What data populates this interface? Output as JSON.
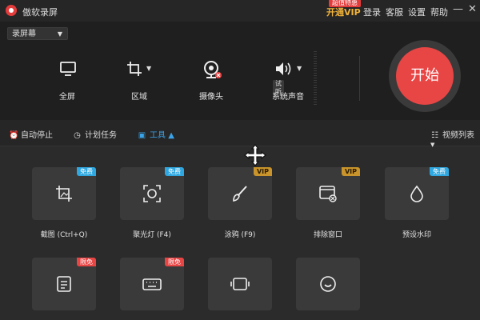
{
  "window": {
    "title": "傲软录屏",
    "vip_link": "开通VIP",
    "vip_badge": "超值特惠",
    "login": "登录",
    "support": "客服",
    "settings": "设置",
    "help": "帮助",
    "minimize": "—",
    "close": "✕"
  },
  "mode": {
    "selected": "录屏幕"
  },
  "tools": {
    "fullscreen": "全屏",
    "region": "区域",
    "camera": "摄像头",
    "audio": "系统声音",
    "audio_test": "试听"
  },
  "start": {
    "label": "开始"
  },
  "toolbar": {
    "auto_stop": "自动停止",
    "schedule": "计划任务",
    "tools": "工具",
    "video_list": "视频列表"
  },
  "cards": [
    {
      "label": "截图 (Ctrl+Q)",
      "badge": "免费",
      "icon": "crop-screenshot-icon"
    },
    {
      "label": "聚光灯 (F4)",
      "badge": "免费",
      "icon": "spotlight-icon"
    },
    {
      "label": "涂鸦 (F9)",
      "badge": "VIP",
      "icon": "brush-icon"
    },
    {
      "label": "排除窗口",
      "badge": "VIP",
      "icon": "exclude-window-icon"
    },
    {
      "label": "预设水印",
      "badge": "免费",
      "icon": "watermark-drop-icon"
    },
    {
      "label": "",
      "badge": "限免",
      "icon": "document-icon"
    },
    {
      "label": "",
      "badge": "限免",
      "icon": "keyboard-icon"
    },
    {
      "label": "",
      "badge": "",
      "icon": "video-frame-icon"
    },
    {
      "label": "",
      "badge": "",
      "icon": "circle-arc-icon"
    }
  ],
  "colors": {
    "accent": "#e84545",
    "vip": "#f0b23a",
    "active": "#3aa3e8",
    "free_badge": "#2fa7e0",
    "vip_badge": "#c8942b"
  }
}
